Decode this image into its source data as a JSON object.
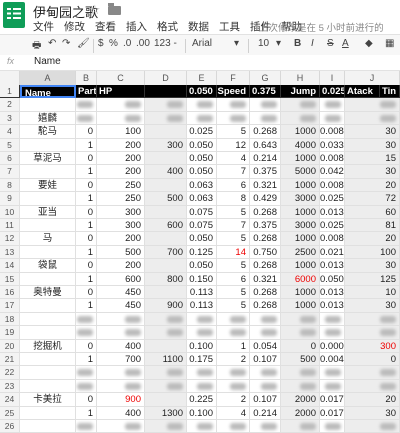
{
  "window": {
    "title": "伊甸园之歌",
    "star": "☆"
  },
  "menu": [
    "文件",
    "修改",
    "查看",
    "插入",
    "格式",
    "数据",
    "工具",
    "插件",
    "帮助"
  ],
  "last_edit": "上次修改是在 5 小时前进行的",
  "toolbar": {
    "zoom_pct": "%",
    "decimals_0": ".0",
    "decimals_00": ".00",
    "format_123": "123 -",
    "font": "Arial",
    "size": "10",
    "bold": "B",
    "italic": "I",
    "strike": "S",
    "text_color": "A"
  },
  "formula_bar": {
    "fx": "fx",
    "value": "Name"
  },
  "columns": [
    "A",
    "B",
    "C",
    "D",
    "E",
    "F",
    "G",
    "H",
    "I",
    "J"
  ],
  "header_row": [
    "Name",
    "Part",
    "HP",
    "",
    "0.050",
    "Speed",
    "0.375",
    "Jump",
    "0.025",
    "Atack",
    "Tin"
  ],
  "rows": [
    {
      "num": "3",
      "name": "嬉麟",
      "b": "",
      "c": "",
      "d": "",
      "e": "",
      "f": "",
      "g": "",
      "h": "",
      "i": "",
      "j": "",
      "blur": true
    },
    {
      "num": "4",
      "name": "駝马",
      "b": "0",
      "c": "100",
      "d": "",
      "e": "0.025",
      "f": "5",
      "g": "0.268",
      "h": "1000",
      "i": "0.008",
      "j": "30"
    },
    {
      "num": "5",
      "name": "",
      "b": "1",
      "c": "200",
      "d": "300",
      "e": "0.050",
      "f": "12",
      "g": "0.643",
      "h": "4000",
      "i": "0.033",
      "j": "30"
    },
    {
      "num": "6",
      "name": "草泥马",
      "b": "0",
      "c": "200",
      "d": "",
      "e": "0.050",
      "f": "4",
      "g": "0.214",
      "h": "1000",
      "i": "0.008",
      "j": "15"
    },
    {
      "num": "7",
      "name": "",
      "b": "1",
      "c": "200",
      "d": "400",
      "e": "0.050",
      "f": "7",
      "g": "0.375",
      "h": "5000",
      "i": "0.042",
      "j": "30"
    },
    {
      "num": "8",
      "name": "要娃",
      "b": "0",
      "c": "250",
      "d": "",
      "e": "0.063",
      "f": "6",
      "g": "0.321",
      "h": "1000",
      "i": "0.008",
      "j": "20"
    },
    {
      "num": "9",
      "name": "",
      "b": "1",
      "c": "250",
      "d": "500",
      "e": "0.063",
      "f": "8",
      "g": "0.429",
      "h": "3000",
      "i": "0.025",
      "j": "72"
    },
    {
      "num": "10",
      "name": "亚当",
      "b": "0",
      "c": "300",
      "d": "",
      "e": "0.075",
      "f": "5",
      "g": "0.268",
      "h": "1000",
      "i": "0.013",
      "j": "60"
    },
    {
      "num": "11",
      "name": "",
      "b": "1",
      "c": "300",
      "d": "600",
      "e": "0.075",
      "f": "7",
      "g": "0.375",
      "h": "3000",
      "i": "0.025",
      "j": "81"
    },
    {
      "num": "12",
      "name": "马",
      "b": "0",
      "c": "200",
      "d": "",
      "e": "0.050",
      "f": "5",
      "g": "0.268",
      "h": "1000",
      "i": "0.008",
      "j": "20"
    },
    {
      "num": "13",
      "name": "",
      "b": "1",
      "c": "500",
      "d": "700",
      "e": "0.125",
      "f": "14",
      "g": "0.750",
      "h": "2500",
      "i": "0.021",
      "j": "100",
      "f_red": true
    },
    {
      "num": "14",
      "name": "袋鼠",
      "b": "0",
      "c": "200",
      "d": "",
      "e": "0.050",
      "f": "5",
      "g": "0.268",
      "h": "1000",
      "i": "0.013",
      "j": "30"
    },
    {
      "num": "15",
      "name": "",
      "b": "1",
      "c": "600",
      "d": "800",
      "e": "0.150",
      "f": "6",
      "g": "0.321",
      "h": "6000",
      "i": "0.050",
      "j": "125",
      "h_red": true
    },
    {
      "num": "16",
      "name": "奥特曼",
      "b": "0",
      "c": "450",
      "d": "",
      "e": "0.113",
      "f": "5",
      "g": "0.268",
      "h": "1000",
      "i": "0.013",
      "j": "10"
    },
    {
      "num": "17",
      "name": "",
      "b": "1",
      "c": "450",
      "d": "900",
      "e": "0.113",
      "f": "5",
      "g": "0.268",
      "h": "1000",
      "i": "0.013",
      "j": "30"
    },
    {
      "num": "18",
      "name": "",
      "b": "",
      "c": "",
      "d": "",
      "e": "",
      "f": "",
      "g": "",
      "h": "",
      "i": "",
      "j": "",
      "blur": true
    },
    {
      "num": "19",
      "name": "",
      "b": "",
      "c": "",
      "d": "",
      "e": "",
      "f": "",
      "g": "",
      "h": "",
      "i": "",
      "j": "",
      "blur": true
    },
    {
      "num": "20",
      "name": "挖掘机",
      "b": "0",
      "c": "400",
      "d": "",
      "e": "0.100",
      "f": "1",
      "g": "0.054",
      "h": "0",
      "i": "0.000",
      "j": "300",
      "j_red": true
    },
    {
      "num": "21",
      "name": "",
      "b": "1",
      "c": "700",
      "d": "1100",
      "e": "0.175",
      "f": "2",
      "g": "0.107",
      "h": "500",
      "i": "0.004",
      "j": "0"
    },
    {
      "num": "22",
      "name": "",
      "b": "",
      "c": "",
      "d": "",
      "e": "",
      "f": "",
      "g": "",
      "h": "",
      "i": "",
      "j": "",
      "blur": true
    },
    {
      "num": "23",
      "name": "",
      "b": "",
      "c": "",
      "d": "",
      "e": "",
      "f": "",
      "g": "",
      "h": "",
      "i": "",
      "j": "",
      "blur": true
    },
    {
      "num": "24",
      "name": "卡美拉",
      "b": "0",
      "c": "900",
      "d": "",
      "e": "0.225",
      "f": "2",
      "g": "0.107",
      "h": "2000",
      "i": "0.017",
      "j": "20",
      "c_red": true
    },
    {
      "num": "25",
      "name": "",
      "b": "1",
      "c": "400",
      "d": "1300",
      "e": "0.100",
      "f": "4",
      "g": "0.214",
      "h": "2000",
      "i": "0.017",
      "j": "30"
    },
    {
      "num": "26",
      "name": "",
      "b": "",
      "c": "",
      "d": "",
      "e": "",
      "f": "",
      "g": "",
      "h": "",
      "i": "",
      "j": "",
      "blur": true
    }
  ]
}
